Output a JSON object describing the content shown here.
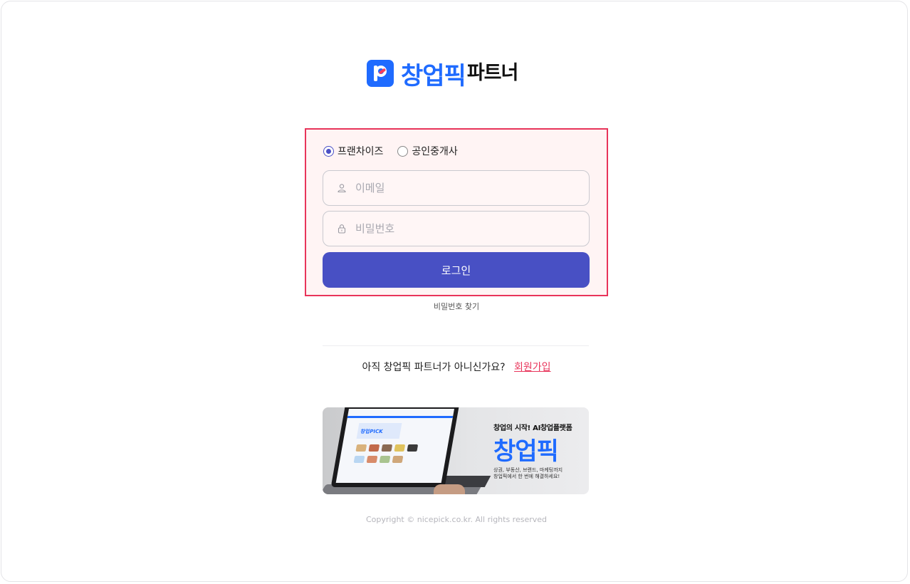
{
  "logo": {
    "brand": "창업픽",
    "suffix": "파트너"
  },
  "login": {
    "user_types": [
      {
        "label": "프랜차이즈",
        "selected": true
      },
      {
        "label": "공인중개사",
        "selected": false
      }
    ],
    "email_placeholder": "이메일",
    "password_placeholder": "비밀번호",
    "submit_label": "로그인"
  },
  "find_password_label": "비밀번호 찾기",
  "signup": {
    "prompt": "아직 창업픽 파트너가 아니신가요?",
    "link_label": "회원가입"
  },
  "banner": {
    "tagline": "창업의 시작! AI창업플랫폼",
    "title": "창업픽",
    "subtitle_line1": "상권, 부동산, 브랜드, 마케팅까지",
    "subtitle_line2": "창업픽에서 한 번에 해결하세요!",
    "screen_logo_text": "창업PICK"
  },
  "copyright": "Copyright © nicepick.co.kr. All rights reserved",
  "colors": {
    "brand_blue": "#1f6bff",
    "button": "#4850c4",
    "accent_red": "#e8345a"
  },
  "icons": {
    "email_icon": "user-icon",
    "password_icon": "lock-icon"
  }
}
